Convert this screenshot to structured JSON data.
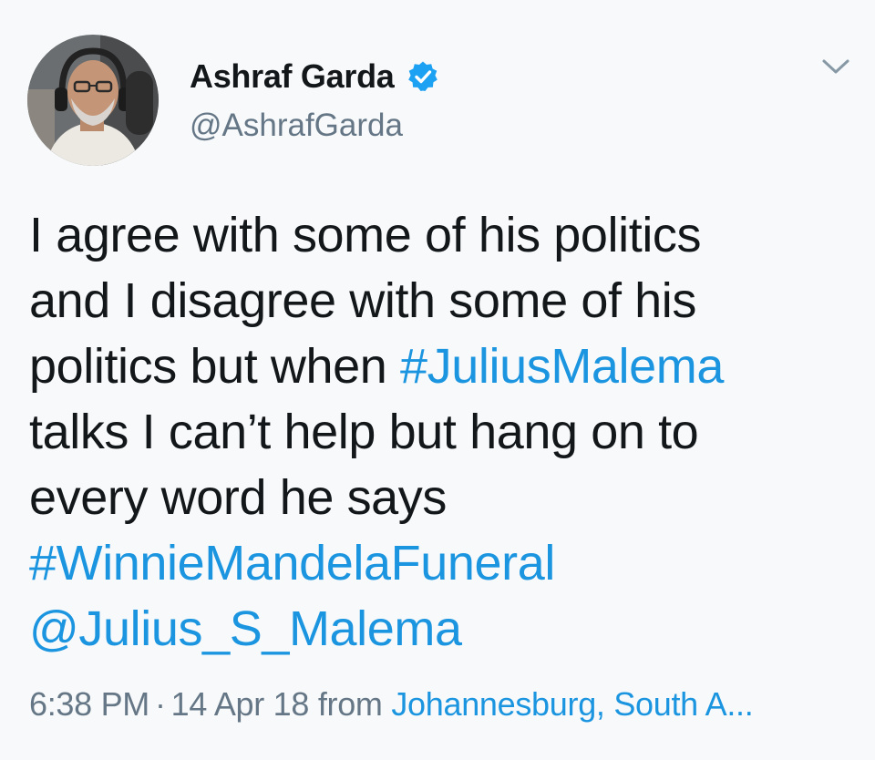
{
  "author": {
    "display_name": "Ashraf Garda",
    "handle": "@AshrafGarda",
    "verified_icon": "verified-badge-icon",
    "avatar": "profile-photo"
  },
  "menu": {
    "icon": "chevron-down-icon"
  },
  "tweet": {
    "lines": [
      {
        "segments": [
          {
            "text": "I agree with some of his politics",
            "link": false
          }
        ]
      },
      {
        "segments": [
          {
            "text": "and I disagree with some of his",
            "link": false
          }
        ]
      },
      {
        "segments": [
          {
            "text": "politics but when ",
            "link": false
          },
          {
            "text": "#JuliusMalema",
            "link": true
          }
        ]
      },
      {
        "segments": [
          {
            "text": "talks I can’t help but hang on to",
            "link": false
          }
        ]
      },
      {
        "segments": [
          {
            "text": "every word he says",
            "link": false
          }
        ]
      },
      {
        "segments": [
          {
            "text": "#WinnieMandelaFuneral",
            "link": true
          }
        ]
      },
      {
        "segments": [
          {
            "text": "@Julius_S_Malema",
            "link": true
          }
        ]
      }
    ]
  },
  "meta": {
    "time": "6:38 PM",
    "separator": "·",
    "date": "14 Apr 18",
    "from_label": "from",
    "location": "Johannesburg, South A..."
  },
  "colors": {
    "link": "#1b95e0",
    "text": "#14171a",
    "secondary": "#657786",
    "background": "#f7f9fa"
  }
}
